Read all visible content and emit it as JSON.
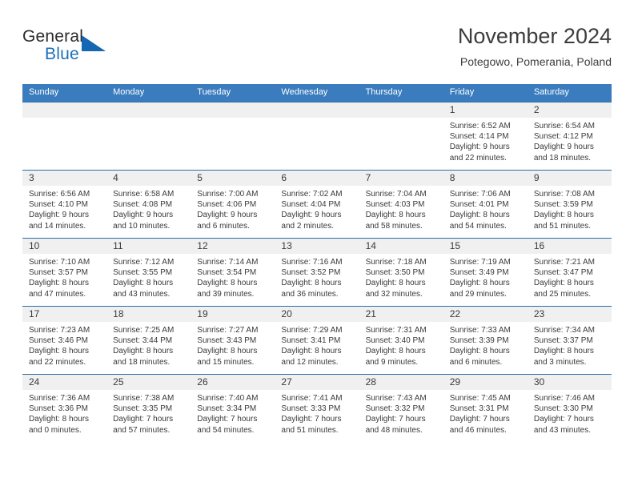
{
  "brand": {
    "name_part1": "General",
    "name_part2": "Blue",
    "accent_color": "#1566b3",
    "logo_icon": "triangle-icon"
  },
  "header": {
    "title": "November 2024",
    "subtitle": "Potegowo, Pomerania, Poland"
  },
  "calendar": {
    "header_bg": "#3a7cbd",
    "daynum_bg": "#f0f0f0",
    "weekdays": [
      "Sunday",
      "Monday",
      "Tuesday",
      "Wednesday",
      "Thursday",
      "Friday",
      "Saturday"
    ],
    "weeks": [
      [
        {
          "day": "",
          "lines": []
        },
        {
          "day": "",
          "lines": []
        },
        {
          "day": "",
          "lines": []
        },
        {
          "day": "",
          "lines": []
        },
        {
          "day": "",
          "lines": []
        },
        {
          "day": "1",
          "lines": [
            "Sunrise: 6:52 AM",
            "Sunset: 4:14 PM",
            "Daylight: 9 hours",
            "and 22 minutes."
          ]
        },
        {
          "day": "2",
          "lines": [
            "Sunrise: 6:54 AM",
            "Sunset: 4:12 PM",
            "Daylight: 9 hours",
            "and 18 minutes."
          ]
        }
      ],
      [
        {
          "day": "3",
          "lines": [
            "Sunrise: 6:56 AM",
            "Sunset: 4:10 PM",
            "Daylight: 9 hours",
            "and 14 minutes."
          ]
        },
        {
          "day": "4",
          "lines": [
            "Sunrise: 6:58 AM",
            "Sunset: 4:08 PM",
            "Daylight: 9 hours",
            "and 10 minutes."
          ]
        },
        {
          "day": "5",
          "lines": [
            "Sunrise: 7:00 AM",
            "Sunset: 4:06 PM",
            "Daylight: 9 hours",
            "and 6 minutes."
          ]
        },
        {
          "day": "6",
          "lines": [
            "Sunrise: 7:02 AM",
            "Sunset: 4:04 PM",
            "Daylight: 9 hours",
            "and 2 minutes."
          ]
        },
        {
          "day": "7",
          "lines": [
            "Sunrise: 7:04 AM",
            "Sunset: 4:03 PM",
            "Daylight: 8 hours",
            "and 58 minutes."
          ]
        },
        {
          "day": "8",
          "lines": [
            "Sunrise: 7:06 AM",
            "Sunset: 4:01 PM",
            "Daylight: 8 hours",
            "and 54 minutes."
          ]
        },
        {
          "day": "9",
          "lines": [
            "Sunrise: 7:08 AM",
            "Sunset: 3:59 PM",
            "Daylight: 8 hours",
            "and 51 minutes."
          ]
        }
      ],
      [
        {
          "day": "10",
          "lines": [
            "Sunrise: 7:10 AM",
            "Sunset: 3:57 PM",
            "Daylight: 8 hours",
            "and 47 minutes."
          ]
        },
        {
          "day": "11",
          "lines": [
            "Sunrise: 7:12 AM",
            "Sunset: 3:55 PM",
            "Daylight: 8 hours",
            "and 43 minutes."
          ]
        },
        {
          "day": "12",
          "lines": [
            "Sunrise: 7:14 AM",
            "Sunset: 3:54 PM",
            "Daylight: 8 hours",
            "and 39 minutes."
          ]
        },
        {
          "day": "13",
          "lines": [
            "Sunrise: 7:16 AM",
            "Sunset: 3:52 PM",
            "Daylight: 8 hours",
            "and 36 minutes."
          ]
        },
        {
          "day": "14",
          "lines": [
            "Sunrise: 7:18 AM",
            "Sunset: 3:50 PM",
            "Daylight: 8 hours",
            "and 32 minutes."
          ]
        },
        {
          "day": "15",
          "lines": [
            "Sunrise: 7:19 AM",
            "Sunset: 3:49 PM",
            "Daylight: 8 hours",
            "and 29 minutes."
          ]
        },
        {
          "day": "16",
          "lines": [
            "Sunrise: 7:21 AM",
            "Sunset: 3:47 PM",
            "Daylight: 8 hours",
            "and 25 minutes."
          ]
        }
      ],
      [
        {
          "day": "17",
          "lines": [
            "Sunrise: 7:23 AM",
            "Sunset: 3:46 PM",
            "Daylight: 8 hours",
            "and 22 minutes."
          ]
        },
        {
          "day": "18",
          "lines": [
            "Sunrise: 7:25 AM",
            "Sunset: 3:44 PM",
            "Daylight: 8 hours",
            "and 18 minutes."
          ]
        },
        {
          "day": "19",
          "lines": [
            "Sunrise: 7:27 AM",
            "Sunset: 3:43 PM",
            "Daylight: 8 hours",
            "and 15 minutes."
          ]
        },
        {
          "day": "20",
          "lines": [
            "Sunrise: 7:29 AM",
            "Sunset: 3:41 PM",
            "Daylight: 8 hours",
            "and 12 minutes."
          ]
        },
        {
          "day": "21",
          "lines": [
            "Sunrise: 7:31 AM",
            "Sunset: 3:40 PM",
            "Daylight: 8 hours",
            "and 9 minutes."
          ]
        },
        {
          "day": "22",
          "lines": [
            "Sunrise: 7:33 AM",
            "Sunset: 3:39 PM",
            "Daylight: 8 hours",
            "and 6 minutes."
          ]
        },
        {
          "day": "23",
          "lines": [
            "Sunrise: 7:34 AM",
            "Sunset: 3:37 PM",
            "Daylight: 8 hours",
            "and 3 minutes."
          ]
        }
      ],
      [
        {
          "day": "24",
          "lines": [
            "Sunrise: 7:36 AM",
            "Sunset: 3:36 PM",
            "Daylight: 8 hours",
            "and 0 minutes."
          ]
        },
        {
          "day": "25",
          "lines": [
            "Sunrise: 7:38 AM",
            "Sunset: 3:35 PM",
            "Daylight: 7 hours",
            "and 57 minutes."
          ]
        },
        {
          "day": "26",
          "lines": [
            "Sunrise: 7:40 AM",
            "Sunset: 3:34 PM",
            "Daylight: 7 hours",
            "and 54 minutes."
          ]
        },
        {
          "day": "27",
          "lines": [
            "Sunrise: 7:41 AM",
            "Sunset: 3:33 PM",
            "Daylight: 7 hours",
            "and 51 minutes."
          ]
        },
        {
          "day": "28",
          "lines": [
            "Sunrise: 7:43 AM",
            "Sunset: 3:32 PM",
            "Daylight: 7 hours",
            "and 48 minutes."
          ]
        },
        {
          "day": "29",
          "lines": [
            "Sunrise: 7:45 AM",
            "Sunset: 3:31 PM",
            "Daylight: 7 hours",
            "and 46 minutes."
          ]
        },
        {
          "day": "30",
          "lines": [
            "Sunrise: 7:46 AM",
            "Sunset: 3:30 PM",
            "Daylight: 7 hours",
            "and 43 minutes."
          ]
        }
      ]
    ]
  }
}
